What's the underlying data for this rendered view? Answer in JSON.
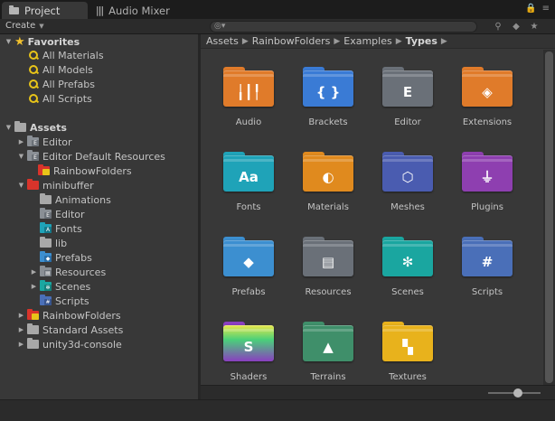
{
  "tabs": [
    {
      "label": "Project",
      "icon": "folder-icon"
    },
    {
      "label": "Audio Mixer",
      "icon": "mixer-icon"
    }
  ],
  "toolbar": {
    "create_label": "Create"
  },
  "favorites": {
    "label": "Favorites",
    "items": [
      "All Materials",
      "All Models",
      "All Prefabs",
      "All Scripts"
    ]
  },
  "assets_root": "Assets",
  "tree": [
    {
      "label": "Editor"
    },
    {
      "label": "Editor Default Resources"
    },
    {
      "label": "RainbowFolders"
    },
    {
      "label": "minibuffer"
    },
    {
      "label": "Animations"
    },
    {
      "label": "Editor"
    },
    {
      "label": "Fonts"
    },
    {
      "label": "lib"
    },
    {
      "label": "Prefabs"
    },
    {
      "label": "Resources"
    },
    {
      "label": "Scenes"
    },
    {
      "label": "Scripts"
    },
    {
      "label": "RainbowFolders"
    },
    {
      "label": "Standard Assets"
    },
    {
      "label": "unity3d-console"
    }
  ],
  "breadcrumb": [
    "Assets",
    "RainbowFolders",
    "Examples",
    "Types"
  ],
  "folders": [
    {
      "label": "Audio",
      "color": "#e07b2a",
      "icon": "audio-wave-icon"
    },
    {
      "label": "Brackets",
      "color": "#3a7bd5",
      "icon": "brackets-icon"
    },
    {
      "label": "Editor",
      "color": "#6a7078",
      "icon": "editor-e-icon"
    },
    {
      "label": "Extensions",
      "color": "#e07b2a",
      "icon": "extension-diamond-icon"
    },
    {
      "label": "Fonts",
      "color": "#1fa3b8",
      "icon": "font-aa-icon"
    },
    {
      "label": "Materials",
      "color": "#e08a1e",
      "icon": "material-sphere-icon"
    },
    {
      "label": "Meshes",
      "color": "#4a5cb0",
      "icon": "mesh-cube-icon"
    },
    {
      "label": "Plugins",
      "color": "#8e3fb0",
      "icon": "plug-icon"
    },
    {
      "label": "Prefabs",
      "color": "#3c8fd0",
      "icon": "prefab-cube-icon"
    },
    {
      "label": "Resources",
      "color": "#6a7078",
      "icon": "resources-zip-icon"
    },
    {
      "label": "Scenes",
      "color": "#1aa6a0",
      "icon": "aperture-icon"
    },
    {
      "label": "Scripts",
      "color": "#4a6fb8",
      "icon": "hash-icon"
    },
    {
      "label": "Shaders",
      "color": "#8a3fc0",
      "icon": "shader-s-icon"
    },
    {
      "label": "Terrains",
      "color": "#3f8f6a",
      "icon": "mountain-icon"
    },
    {
      "label": "Textures",
      "color": "#e8b21c",
      "icon": "checker-icon"
    }
  ]
}
